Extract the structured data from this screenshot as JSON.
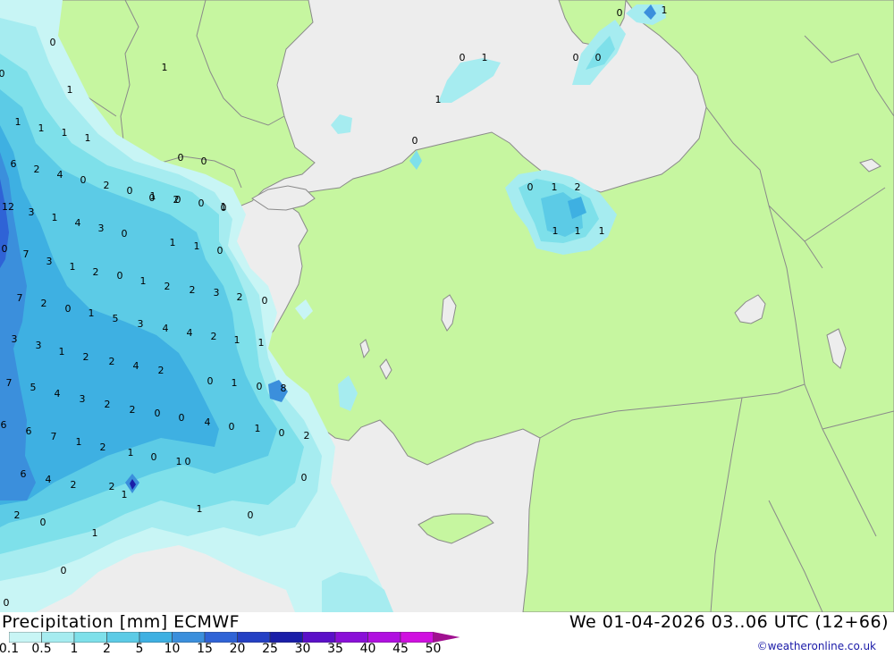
{
  "header": {
    "title": "Precipitation [mm] ECMWF",
    "datetime": "We 01-04-2026 03..06 UTC (12+66)",
    "credit": "©weatheronline.co.uk"
  },
  "legend": {
    "levels": [
      {
        "label": "0.1",
        "color": "#c8f5f5"
      },
      {
        "label": "0.5",
        "color": "#a6ecf0"
      },
      {
        "label": "1",
        "color": "#7ee0ea"
      },
      {
        "label": "2",
        "color": "#5ccbe6"
      },
      {
        "label": "5",
        "color": "#3eb0e2"
      },
      {
        "label": "10",
        "color": "#3b8fdc"
      },
      {
        "label": "15",
        "color": "#2f63d6"
      },
      {
        "label": "20",
        "color": "#2440c4"
      },
      {
        "label": "25",
        "color": "#1a1ea8"
      },
      {
        "label": "30",
        "color": "#5b10c8"
      },
      {
        "label": "35",
        "color": "#8a10d8"
      },
      {
        "label": "40",
        "color": "#b010e0"
      },
      {
        "label": "45",
        "color": "#d010e0"
      },
      {
        "label": "50",
        "color": "#a01090"
      }
    ]
  },
  "colors": {
    "sea": "#ededed",
    "land": "#c6f6a0",
    "border": "#888888",
    "coast": "#888888"
  },
  "map_labels": [
    {
      "v": "0"
    },
    {
      "v": "1"
    },
    {
      "v": "0"
    },
    {
      "v": "1"
    },
    {
      "v": "0"
    },
    {
      "v": "1"
    },
    {
      "v": "0"
    },
    {
      "v": "0"
    },
    {
      "v": "1"
    },
    {
      "v": "1"
    },
    {
      "v": "0"
    },
    {
      "v": "1"
    },
    {
      "v": "1"
    },
    {
      "v": "1"
    },
    {
      "v": "1"
    },
    {
      "v": "0"
    },
    {
      "v": "6"
    },
    {
      "v": "2"
    },
    {
      "v": "4"
    },
    {
      "v": "0"
    },
    {
      "v": "2"
    },
    {
      "v": "0"
    },
    {
      "v": "1"
    },
    {
      "v": "2"
    },
    {
      "v": "0"
    },
    {
      "v": "0"
    },
    {
      "v": "12"
    },
    {
      "v": "3"
    },
    {
      "v": "1"
    },
    {
      "v": "4"
    },
    {
      "v": "3"
    },
    {
      "v": "0"
    },
    {
      "v": "0"
    },
    {
      "v": "7"
    },
    {
      "v": "3"
    },
    {
      "v": "1"
    },
    {
      "v": "2"
    },
    {
      "v": "0"
    },
    {
      "v": "1"
    },
    {
      "v": "2"
    },
    {
      "v": "0"
    },
    {
      "v": "7"
    },
    {
      "v": "2"
    },
    {
      "v": "0"
    },
    {
      "v": "1"
    },
    {
      "v": "5"
    },
    {
      "v": "3"
    },
    {
      "v": "4"
    },
    {
      "v": "2"
    },
    {
      "v": "3"
    },
    {
      "v": "2"
    },
    {
      "v": "0"
    },
    {
      "v": "3"
    },
    {
      "v": "3"
    },
    {
      "v": "1"
    },
    {
      "v": "2"
    },
    {
      "v": "2"
    },
    {
      "v": "4"
    },
    {
      "v": "2"
    },
    {
      "v": "4"
    },
    {
      "v": "2"
    },
    {
      "v": "1"
    },
    {
      "v": "1"
    },
    {
      "v": "7"
    },
    {
      "v": "5"
    },
    {
      "v": "4"
    },
    {
      "v": "3"
    },
    {
      "v": "2"
    },
    {
      "v": "2"
    },
    {
      "v": "0"
    },
    {
      "v": "0"
    },
    {
      "v": "1"
    },
    {
      "v": "0"
    },
    {
      "v": "8"
    },
    {
      "v": "6"
    },
    {
      "v": "6"
    },
    {
      "v": "7"
    },
    {
      "v": "1"
    },
    {
      "v": "2"
    },
    {
      "v": "4"
    },
    {
      "v": "0"
    },
    {
      "v": "1"
    },
    {
      "v": "0"
    },
    {
      "v": "2"
    },
    {
      "v": "1"
    },
    {
      "v": "0"
    },
    {
      "v": "1"
    },
    {
      "v": "6"
    },
    {
      "v": "4"
    },
    {
      "v": "2"
    },
    {
      "v": "1"
    },
    {
      "v": "0"
    },
    {
      "v": "1"
    },
    {
      "v": "0"
    },
    {
      "v": "2"
    },
    {
      "v": "0"
    },
    {
      "v": "1"
    },
    {
      "v": "0"
    },
    {
      "v": "0"
    },
    {
      "v": "1"
    },
    {
      "v": "0"
    },
    {
      "v": "0"
    },
    {
      "v": "0"
    },
    {
      "v": "1"
    },
    {
      "v": "2"
    },
    {
      "v": "1"
    },
    {
      "v": "1"
    },
    {
      "v": "1"
    },
    {
      "v": "2"
    },
    {
      "v": "0"
    },
    {
      "v": "0"
    },
    {
      "v": "0"
    },
    {
      "v": "1"
    },
    {
      "v": "1"
    },
    {
      "v": "0"
    }
  ]
}
